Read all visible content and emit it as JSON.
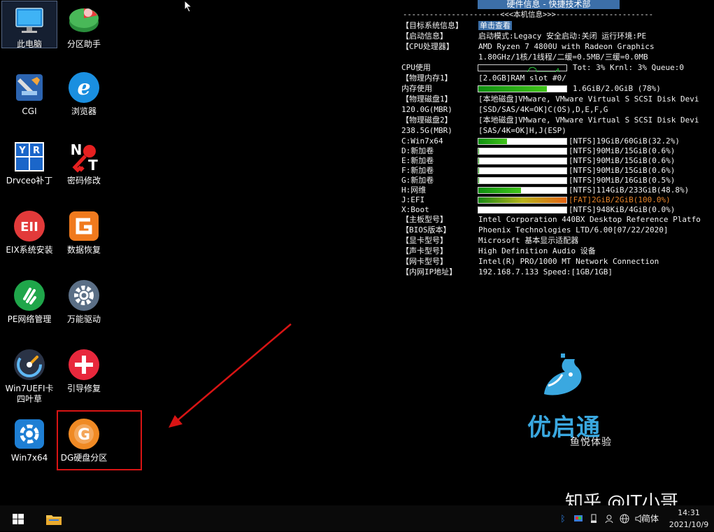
{
  "desktop_icons": [
    {
      "label": "此电脑"
    },
    {
      "label": "分区助手"
    },
    {
      "label": "CGI"
    },
    {
      "label": "浏览器"
    },
    {
      "label": "Drvceo补丁"
    },
    {
      "label": "密码修改"
    },
    {
      "label": "EIX系统安装"
    },
    {
      "label": "数据恢复"
    },
    {
      "label": "PE网络管理"
    },
    {
      "label": "万能驱动"
    },
    {
      "label": "Win7UEFI卡\n四叶草"
    },
    {
      "label": "引导修复"
    },
    {
      "label": "Win7x64"
    },
    {
      "label": "DG硬盘分区"
    }
  ],
  "info": {
    "title": "硬件信息 - 快捷技术部",
    "section_line": "----------------------<<<本机信息>>>----------------------",
    "rows": {
      "target": {
        "key": "【目标系统信息】",
        "button": "单击查看"
      },
      "boot": {
        "key": "【启动信息】",
        "value": "启动模式:Legacy   安全启动:关闭   运行环境:PE"
      },
      "cpu": {
        "key": "【CPU处理器】",
        "value": "AMD Ryzen 7 4800U with Radeon Graphics",
        "value2": "1.80GHz/1核/1线程/二缓=0.5MB/三缓=0.0MB"
      },
      "cpu_use": {
        "key": "  CPU使用",
        "value": "Tot:  3% Krnl:  3% Queue:0"
      },
      "mem": {
        "key": "【物理内存1】",
        "value": "[2.0GB]RAM slot #0/"
      },
      "mem_use": {
        "key": "  内存使用",
        "value": "1.6GiB/2.0GiB (78%)",
        "percent": 78
      },
      "disk1": {
        "key": "【物理磁盘1】",
        "value": "[本地磁盘]VMware, VMware Virtual S SCSI Disk Devi",
        "size": "  120.0G(MBR)",
        "value2": "[SSD/SAS/4K=OK]C(OS),D,E,F,G"
      },
      "disk2": {
        "key": "【物理磁盘2】",
        "value": "[本地磁盘]VMware, VMware Virtual S SCSI Disk Devi",
        "size": "  238.5G(MBR)",
        "value2": "[SAS/4K=OK]H,J(ESP)"
      }
    },
    "volumes": [
      {
        "name": "  C:Win7x64",
        "text": "[NTFS]19GiB/60GiB(32.2%)",
        "percent": 32.2,
        "color": "#f2f2f2"
      },
      {
        "name": "  D:新加卷",
        "text": "[NTFS]90MiB/15GiB(0.6%)",
        "percent": 0.6,
        "color": "#f2f2f2"
      },
      {
        "name": "  E:新加卷",
        "text": "[NTFS]90MiB/15GiB(0.6%)",
        "percent": 0.6,
        "color": "#f2f2f2"
      },
      {
        "name": "  F:新加卷",
        "text": "[NTFS]90MiB/15GiB(0.6%)",
        "percent": 0.6,
        "color": "#f2f2f2"
      },
      {
        "name": "  G:新加卷",
        "text": "[NTFS]90MiB/16GiB(0.5%)",
        "percent": 0.5,
        "color": "#f2f2f2"
      },
      {
        "name": "  H:网维",
        "text": "[NTFS]114GiB/233GiB(48.8%)",
        "percent": 48.8,
        "color": "#f2f2f2"
      },
      {
        "name": "  J:EFI",
        "text": "[FAT]2GiB/2GiB(100.0%)",
        "percent": 100,
        "color": "#e6842a"
      },
      {
        "name": "  X:Boot",
        "text": "[NTFS]948KiB/4GiB(0.0%)",
        "percent": 0,
        "color": "#f2f2f2"
      }
    ],
    "tail": [
      {
        "key": "【主板型号】",
        "value": "Intel Corporation 440BX Desktop Reference Platfo"
      },
      {
        "key": "【BIOS版本】",
        "value": "Phoenix Technologies LTD/6.00[07/22/2020]"
      },
      {
        "key": "【显卡型号】",
        "value": "Microsoft 基本显示适配器"
      },
      {
        "key": "【声卡型号】",
        "value": "High Definition Audio 设备"
      },
      {
        "key": "【网卡型号】",
        "value": "Intel(R) PRO/1000 MT Network Connection"
      },
      {
        "key": "【内网IP地址】",
        "value": "192.168.7.133  Speed:[1GB/1GB]"
      }
    ]
  },
  "logo": {
    "brand": "优启通",
    "tagline": "鱼悦体验",
    "color": "#3aa8e0"
  },
  "watermark": "知乎 @IT小哥",
  "taskbar": {
    "lang": "简体",
    "time": "14:31",
    "date": "2021/10/9"
  },
  "colors": {
    "highlight": "#d81414",
    "accent": "#3c6fa8"
  }
}
